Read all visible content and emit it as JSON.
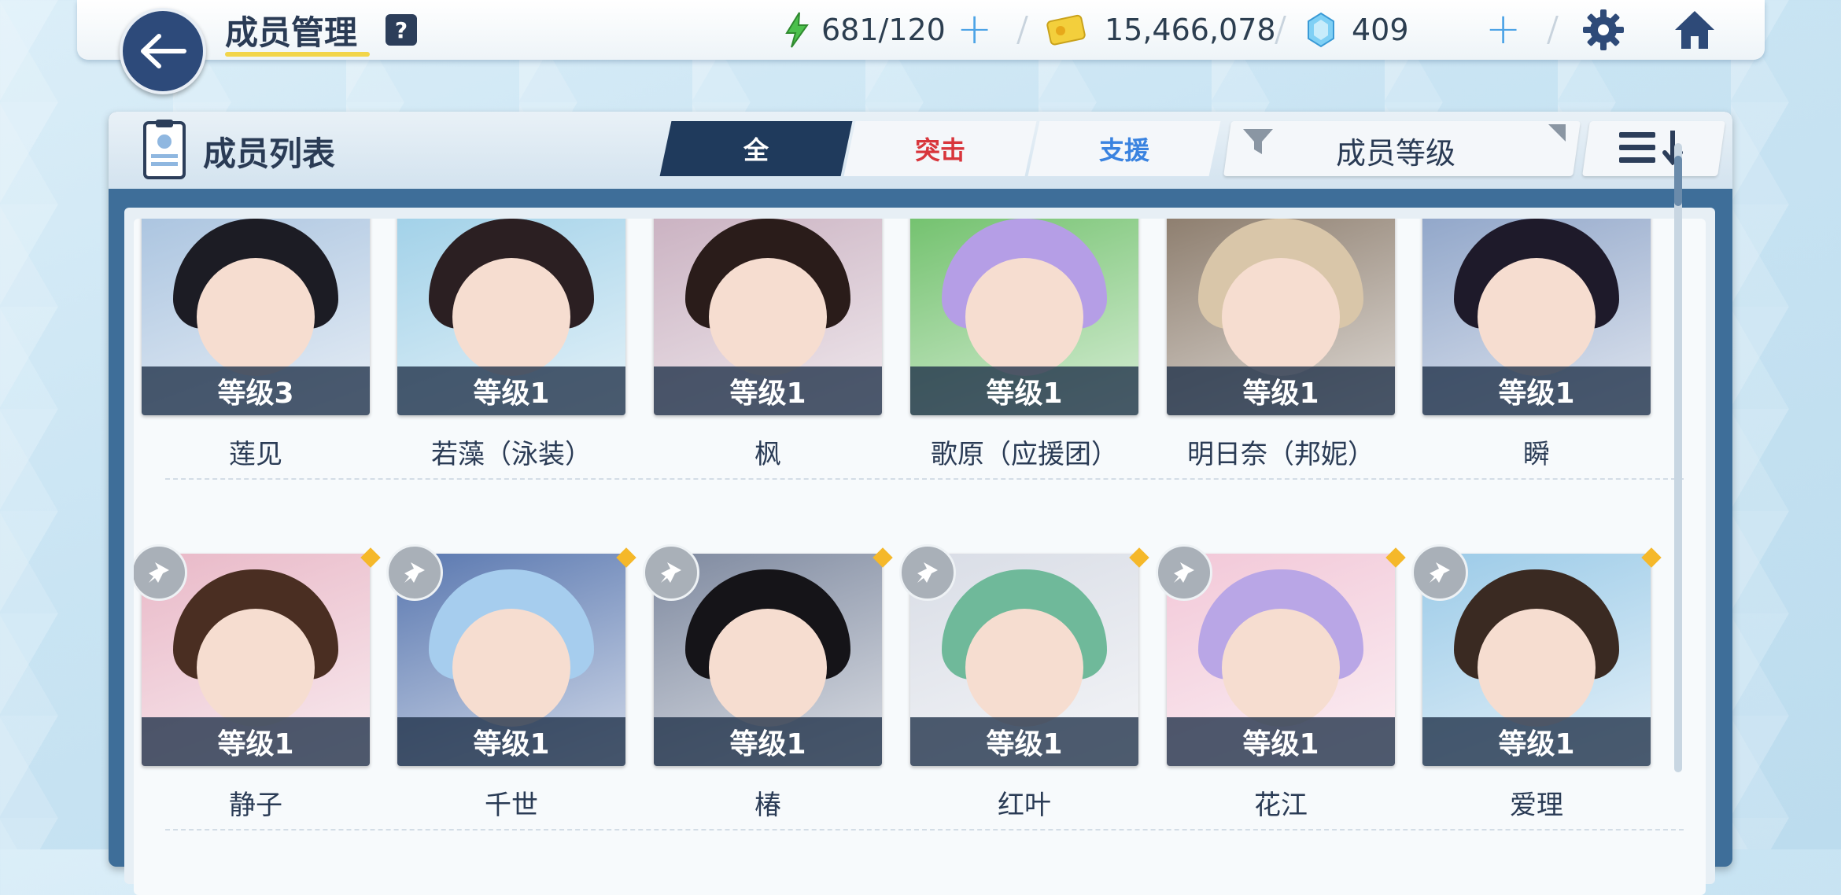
{
  "header": {
    "title": "成员管理",
    "help": "?",
    "ap": "681/120",
    "credits": "15,466,078",
    "gems": "409",
    "plus": "+"
  },
  "panel": {
    "title": "成员列表",
    "tabs": [
      "全",
      "突击",
      "支援"
    ],
    "sort_label": "成员等级"
  },
  "students": [
    {
      "level": "等级3",
      "name": "莲见",
      "hair": "#1c1c24",
      "bg": "#a9c3df"
    },
    {
      "level": "等级1",
      "name": "若藻（泳装）",
      "hair": "#2b1f22",
      "bg": "#9fd0e8"
    },
    {
      "level": "等级1",
      "name": "枫",
      "hair": "#2a1c1a",
      "bg": "#c9b0c0"
    },
    {
      "level": "等级1",
      "name": "歌原（应援团）",
      "hair": "#b59ee6",
      "bg": "#6fc06a"
    },
    {
      "level": "等级1",
      "name": "明日奈（邦妮）",
      "hair": "#d9c6a9",
      "bg": "#8a7a6a"
    },
    {
      "level": "等级1",
      "name": "瞬",
      "hair": "#1e1a2a",
      "bg": "#8ea4c8"
    },
    {
      "level": "等级1",
      "name": "静子",
      "hair": "#4a2e22",
      "bg": "#e9b9c8"
    },
    {
      "level": "等级1",
      "name": "千世",
      "hair": "#a6cdee",
      "bg": "#5a78b0"
    },
    {
      "level": "等级1",
      "name": "椿",
      "hair": "#151418",
      "bg": "#7f8aa0"
    },
    {
      "level": "等级1",
      "name": "红叶",
      "hair": "#6fb99a",
      "bg": "#d9dde6"
    },
    {
      "level": "等级1",
      "name": "花江",
      "hair": "#b9a6e6",
      "bg": "#f2c8d8"
    },
    {
      "level": "等级1",
      "name": "爱理",
      "hair": "#3a2a22",
      "bg": "#9ccbe8"
    }
  ]
}
